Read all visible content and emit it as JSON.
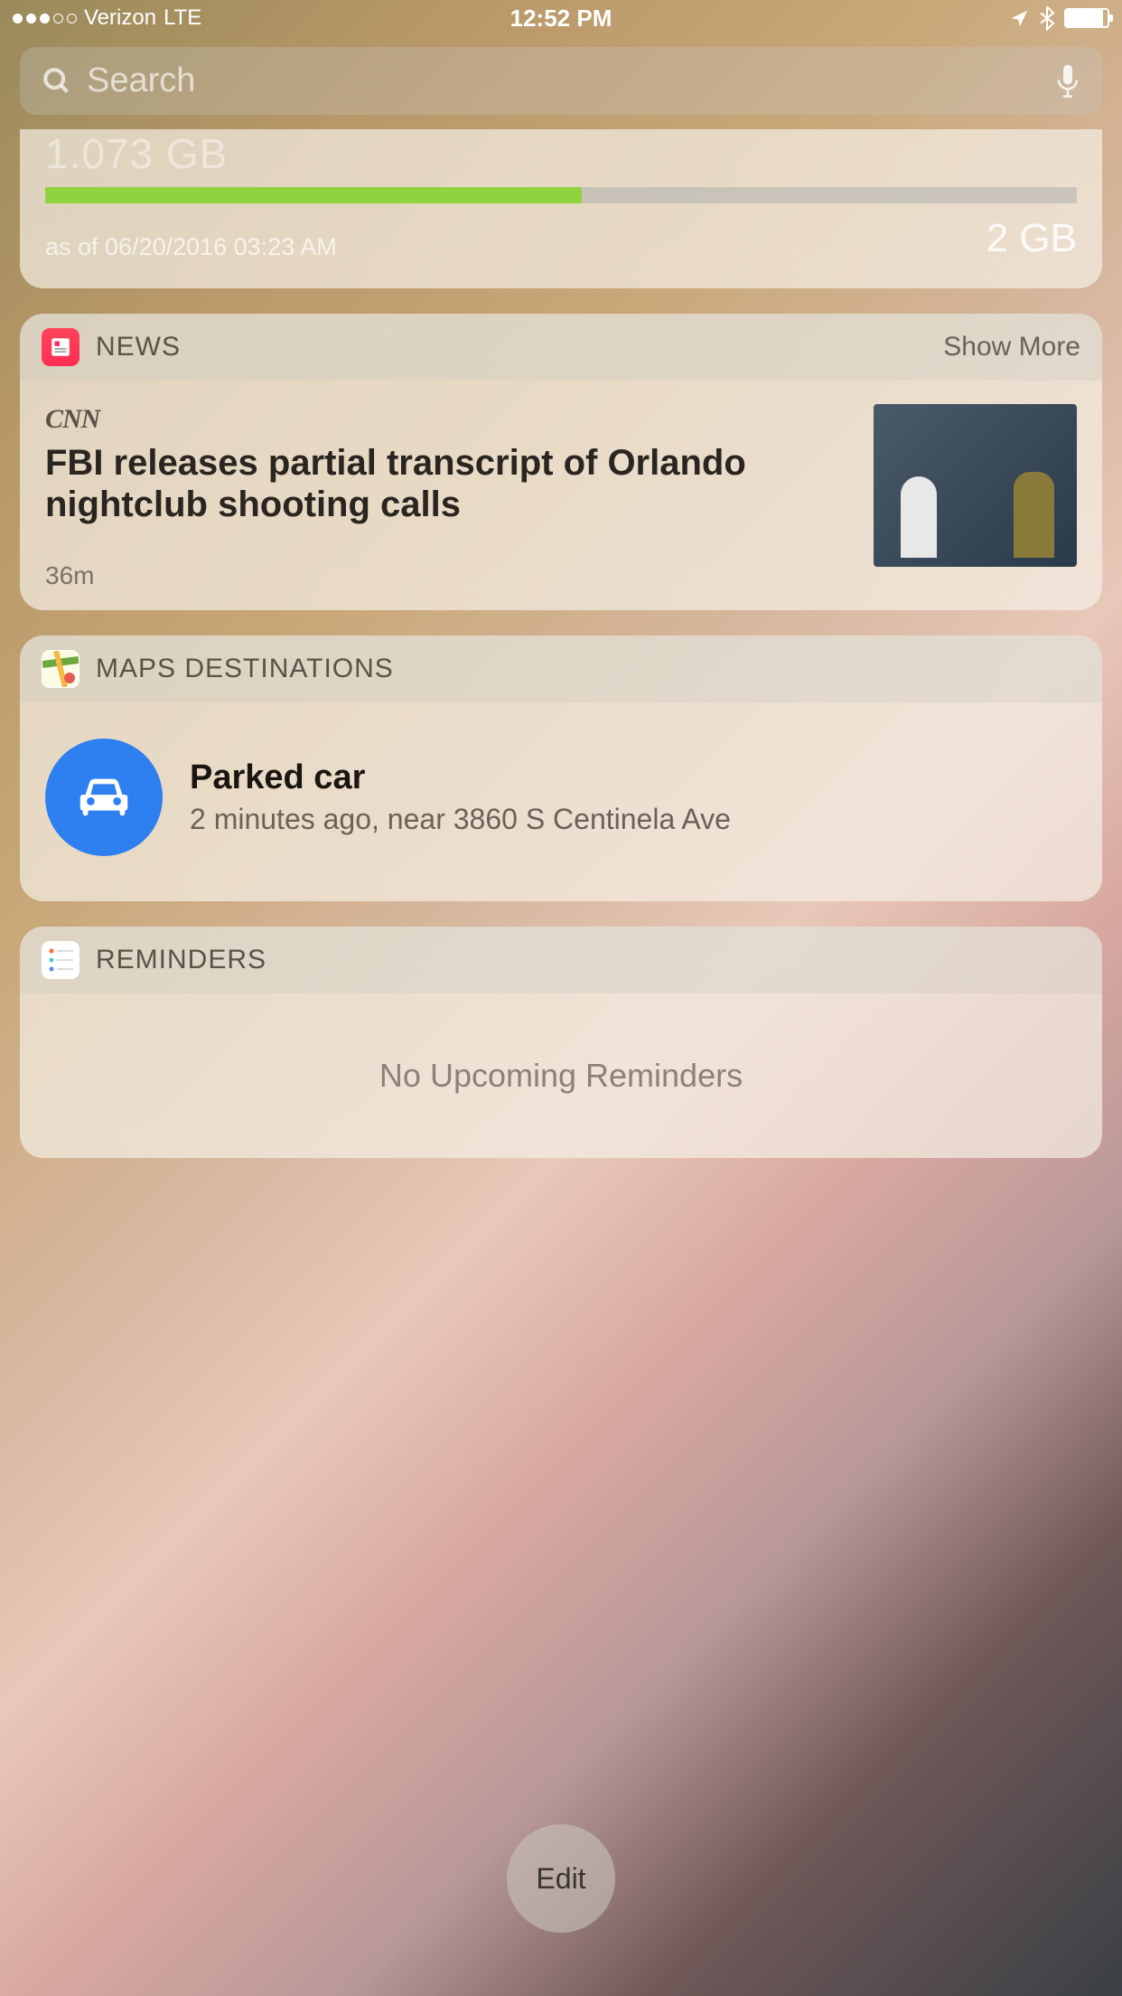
{
  "status": {
    "carrier": "Verizon",
    "network": "LTE",
    "time": "12:52 PM",
    "signal_filled": 3,
    "signal_total": 5
  },
  "search": {
    "placeholder": "Search"
  },
  "data_widget": {
    "used": "1.073 GB",
    "as_of": "as of 06/20/2016 03:23 AM",
    "total": "2 GB",
    "percent": 52
  },
  "news": {
    "title": "NEWS",
    "show_more": "Show More",
    "source": "CNN",
    "headline": "FBI releases partial transcript of Orlando nightclub shooting calls",
    "time": "36m"
  },
  "maps": {
    "title": "MAPS DESTINATIONS",
    "item_title": "Parked car",
    "item_sub": "2 minutes ago, near 3860 S Centinela Ave"
  },
  "reminders": {
    "title": "REMINDERS",
    "empty": "No Upcoming Reminders"
  },
  "edit": "Edit"
}
